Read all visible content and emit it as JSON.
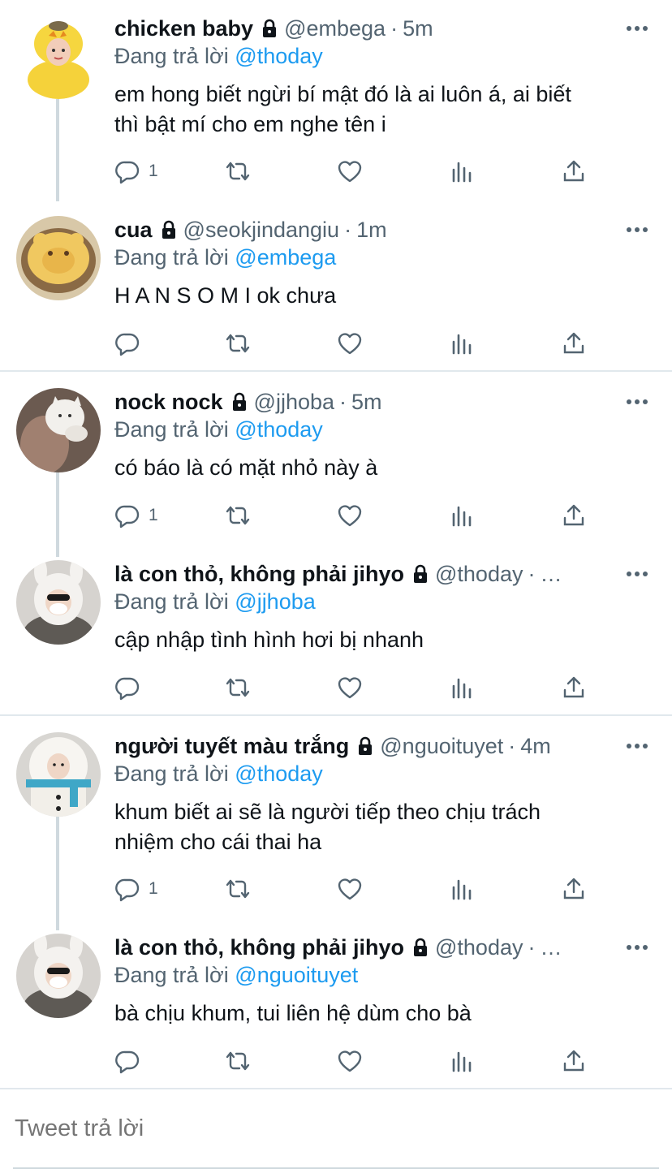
{
  "tweets": [
    {
      "name": "chicken baby",
      "handle": "@embega",
      "dot": "·",
      "time": "5m",
      "reply_prefix": "Đang trả lời",
      "reply_to": "@thoday",
      "text_lines": [
        "em hong biết ngừi bí mật đó là ai luôn á, ai biết",
        "thì bật mí cho em nghe tên i"
      ],
      "reply_count": "1",
      "avatar": "chick-costume-avatar"
    },
    {
      "name": "cua",
      "handle": "@seokjindangiu",
      "dot": "·",
      "time": "1m",
      "reply_prefix": "Đang trả lời",
      "reply_to": "@embega",
      "text_lines": [
        "H A N S O M I ok chưa"
      ],
      "reply_count": "",
      "avatar": "crab-bread-avatar"
    },
    {
      "name": "nock nock",
      "handle": "@jjhoba",
      "dot": "·",
      "time": "5m",
      "reply_prefix": "Đang trả lời",
      "reply_to": "@thoday",
      "text_lines": [
        "có báo là có mặt nhỏ này à"
      ],
      "reply_count": "1",
      "avatar": "white-cat-avatar"
    },
    {
      "name": "là con thỏ, không phải jihyo",
      "handle": "@thoday",
      "dot": "·",
      "time": "…",
      "reply_prefix": "Đang trả lời",
      "reply_to": "@jjhoba",
      "text_lines": [
        "cập nhập tình hình hơi bị nhanh"
      ],
      "reply_count": "",
      "avatar": "bunny-hat-avatar"
    },
    {
      "name": "người tuyết màu trắng",
      "handle": "@nguoituyet",
      "dot": "·",
      "time": "4m",
      "reply_prefix": "Đang trả lời",
      "reply_to": "@thoday",
      "text_lines": [
        "khum biết ai sẽ là người tiếp theo chịu trách",
        "nhiệm cho cái thai ha"
      ],
      "reply_count": "1",
      "avatar": "snowman-costume-avatar"
    },
    {
      "name": "là con thỏ, không phải jihyo",
      "handle": "@thoday",
      "dot": "·",
      "time": "…",
      "reply_prefix": "Đang trả lời",
      "reply_to": "@nguoituyet",
      "text_lines": [
        "bà chịu khum, tui liên hệ dùm cho bà"
      ],
      "reply_count": "",
      "avatar": "bunny-hat-avatar"
    }
  ],
  "compose": {
    "placeholder": "Tweet trả lời"
  },
  "colors": {
    "link": "#1d9bf0",
    "secondary": "#536471",
    "divider": "#e1e8ed",
    "thread": "#cfd9de"
  }
}
